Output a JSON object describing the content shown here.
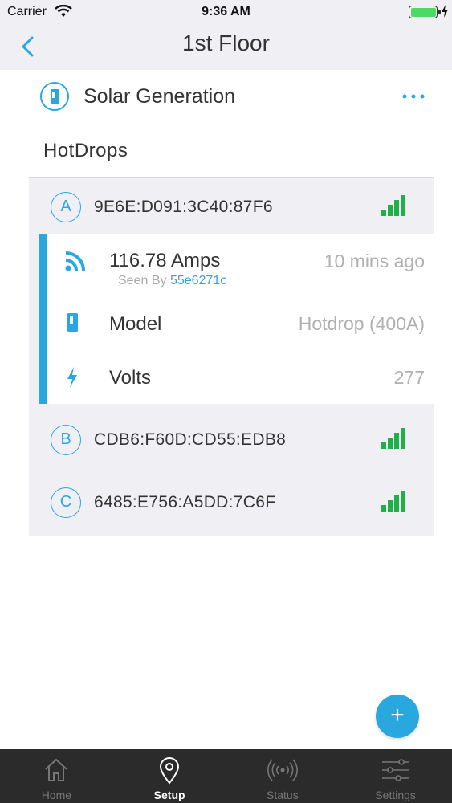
{
  "status_bar": {
    "carrier": "Carrier",
    "time": "9:36 AM"
  },
  "nav": {
    "title": "1st Floor"
  },
  "group": {
    "label": "Solar Generation"
  },
  "section": {
    "title": "HotDrops"
  },
  "devices": [
    {
      "letter": "A",
      "address": "9E6E:D091:3C40:87F6",
      "signal_bars": 4
    },
    {
      "letter": "B",
      "address": "CDB6:F60D:CD55:EDB8",
      "signal_bars": 4
    },
    {
      "letter": "C",
      "address": "6485:E756:A5DD:7C6F",
      "signal_bars": 4
    }
  ],
  "detail": {
    "reading": "116.78 Amps",
    "reading_time": "10 mins ago",
    "seen_by_label": "Seen By",
    "seen_by_id": "55e6271c",
    "model_label": "Model",
    "model_value": "Hotdrop (400A)",
    "volts_label": "Volts",
    "volts_value": "277"
  },
  "fab": {
    "label": "+"
  },
  "tabs": [
    {
      "label": "Home",
      "active": false
    },
    {
      "label": "Setup",
      "active": true
    },
    {
      "label": "Status",
      "active": false
    },
    {
      "label": "Settings",
      "active": false
    }
  ],
  "colors": {
    "accent": "#29a8e0",
    "signal": "#1fb04a",
    "battery": "#4cd964",
    "tab_bar": "#2b2b2b",
    "header_bg": "#efeff4"
  }
}
